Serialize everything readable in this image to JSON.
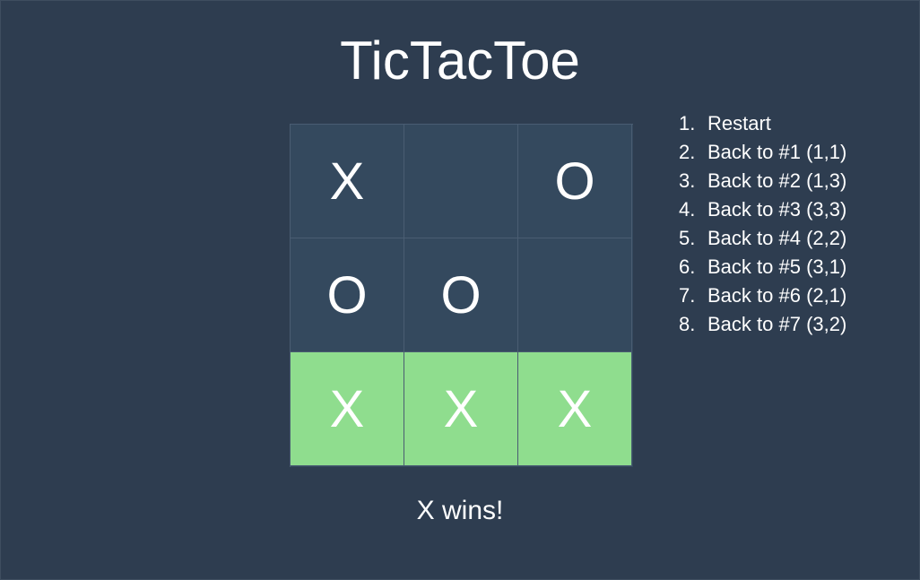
{
  "title": "TicTacToe",
  "colors": {
    "background": "#2e3d50",
    "cell": "#34495e",
    "winning_cell": "#8fdd8e",
    "text": "#ffffff"
  },
  "board": {
    "rows": [
      [
        {
          "value": "X",
          "win": false
        },
        {
          "value": "",
          "win": false
        },
        {
          "value": "O",
          "win": false
        }
      ],
      [
        {
          "value": "O",
          "win": false
        },
        {
          "value": "O",
          "win": false
        },
        {
          "value": "",
          "win": false
        }
      ],
      [
        {
          "value": "X",
          "win": true
        },
        {
          "value": "X",
          "win": true
        },
        {
          "value": "X",
          "win": true
        }
      ]
    ]
  },
  "moves": [
    {
      "num": "1.",
      "label": "Restart"
    },
    {
      "num": "2.",
      "label": "Back to #1 (1,1)"
    },
    {
      "num": "3.",
      "label": "Back to #2 (1,3)"
    },
    {
      "num": "4.",
      "label": "Back to #3 (3,3)"
    },
    {
      "num": "5.",
      "label": "Back to #4 (2,2)"
    },
    {
      "num": "6.",
      "label": "Back to #5 (3,1)"
    },
    {
      "num": "7.",
      "label": "Back to #6 (2,1)"
    },
    {
      "num": "8.",
      "label": "Back to #7 (3,2)"
    }
  ],
  "status": "X wins!"
}
